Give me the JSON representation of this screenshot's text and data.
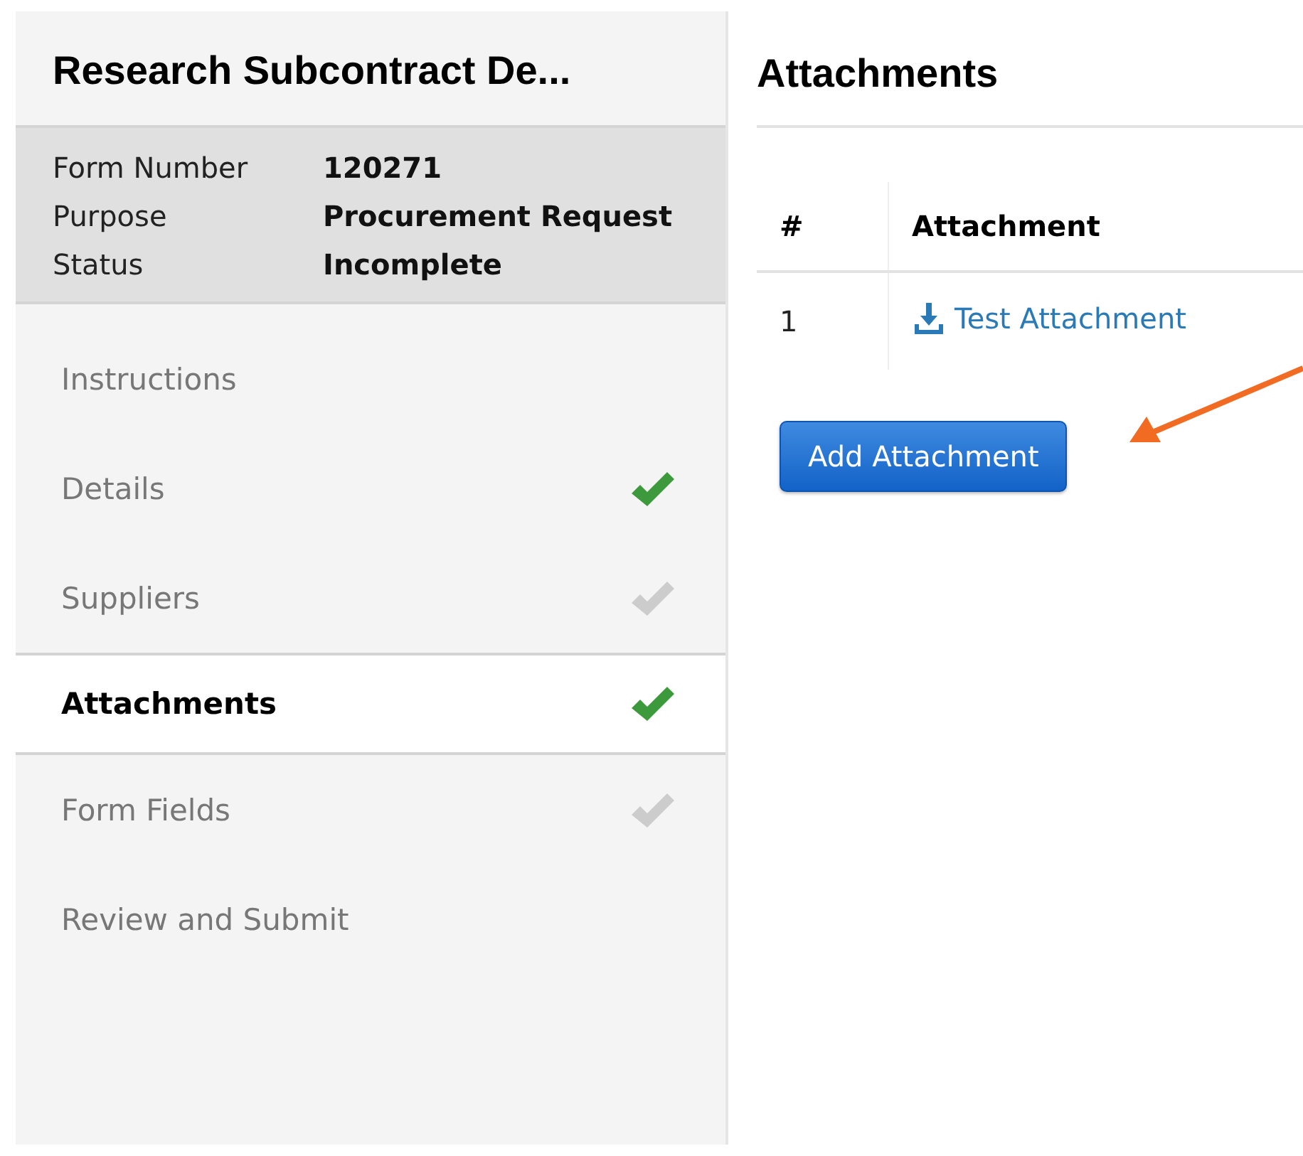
{
  "sidebar": {
    "title": "Research Subcontract De...",
    "info": [
      {
        "label": "Form Number",
        "value": "120271"
      },
      {
        "label": "Purpose",
        "value": "Procurement Request"
      },
      {
        "label": "Status",
        "value": "Incomplete"
      }
    ],
    "steps": [
      {
        "label": "Instructions",
        "selected": false,
        "kind": "plain"
      },
      {
        "label": "Details",
        "selected": false,
        "kind": "done"
      },
      {
        "label": "Suppliers",
        "selected": false,
        "kind": "pending"
      },
      {
        "label": "Attachments",
        "selected": true,
        "kind": "done"
      },
      {
        "label": "Form Fields",
        "selected": false,
        "kind": "pending"
      },
      {
        "label": "Review and Submit",
        "selected": false,
        "kind": "plain"
      }
    ]
  },
  "main": {
    "title": "Attachments",
    "table": {
      "columns": [
        "#",
        "Attachment"
      ],
      "rows": [
        {
          "number": "1",
          "attachment": "Test Attachment"
        }
      ]
    },
    "add_button": "Add Attachment"
  }
}
